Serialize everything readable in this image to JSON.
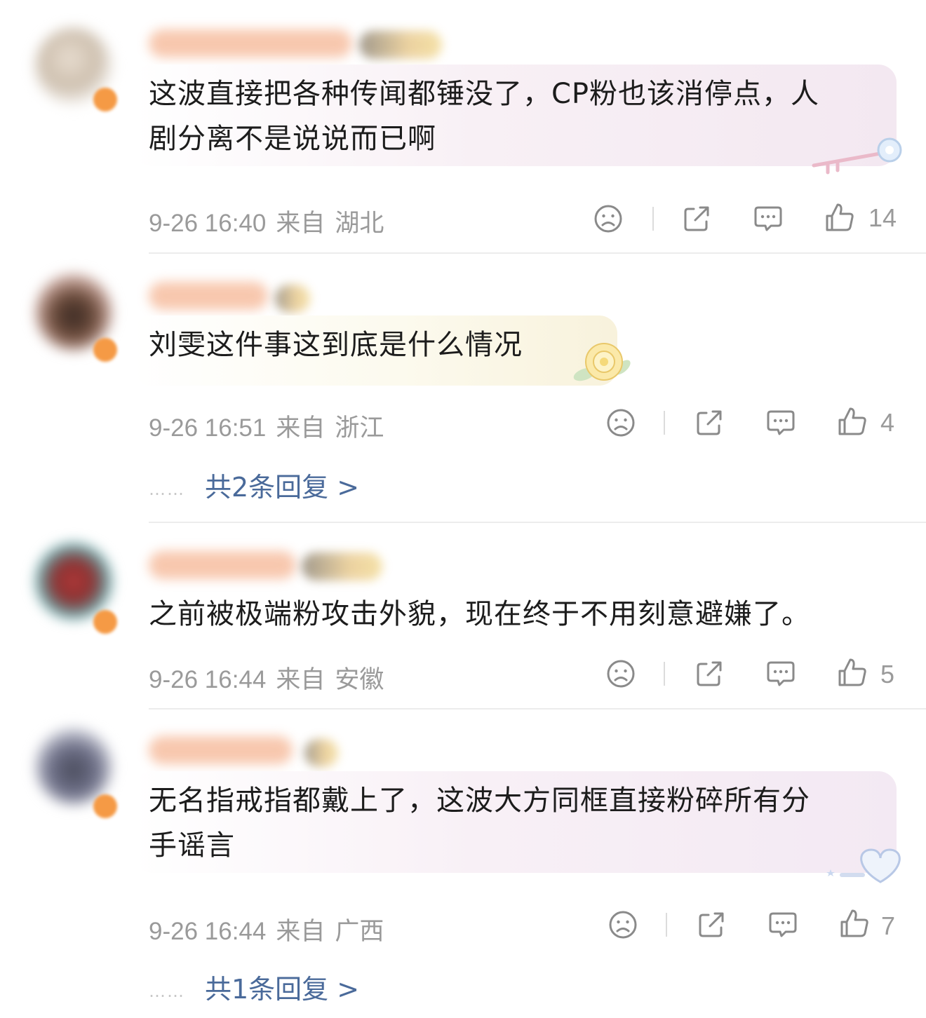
{
  "comments": [
    {
      "text_lines": [
        "这波直接把各种传闻都锤没了，CP粉也该消停点，人",
        "剧分离不是说说而已啊"
      ],
      "date": "9-26 16:40",
      "from_label": "来自",
      "location": "湖北",
      "likes": "14"
    },
    {
      "text_lines": [
        "刘雯这件事这到底是什么情况"
      ],
      "date": "9-26 16:51",
      "from_label": "来自",
      "location": "浙江",
      "likes": "4",
      "replies": {
        "label": "共2条回复 >"
      }
    },
    {
      "text_lines": [
        "之前被极端粉攻击外貌，现在终于不用刻意避嫌了。"
      ],
      "date": "9-26 16:44",
      "from_label": "来自",
      "location": "安徽",
      "likes": "5"
    },
    {
      "text_lines": [
        "无名指戒指都戴上了，这波大方同框直接粉碎所有分",
        "手谣言"
      ],
      "date": "9-26 16:44",
      "from_label": "来自",
      "location": "广西",
      "likes": "7",
      "replies": {
        "label": "共1条回复 >"
      }
    }
  ],
  "icons": {
    "dislike": "sad-face-icon",
    "share": "share-icon",
    "comment": "comment-icon",
    "like": "thumbs-up-icon"
  },
  "colors": {
    "meta_text": "#9a9a9a",
    "reply_link": "#4a6a9a",
    "bubble_pink": "#f6eaf2",
    "bubble_yellow": "#fbf6e3"
  }
}
